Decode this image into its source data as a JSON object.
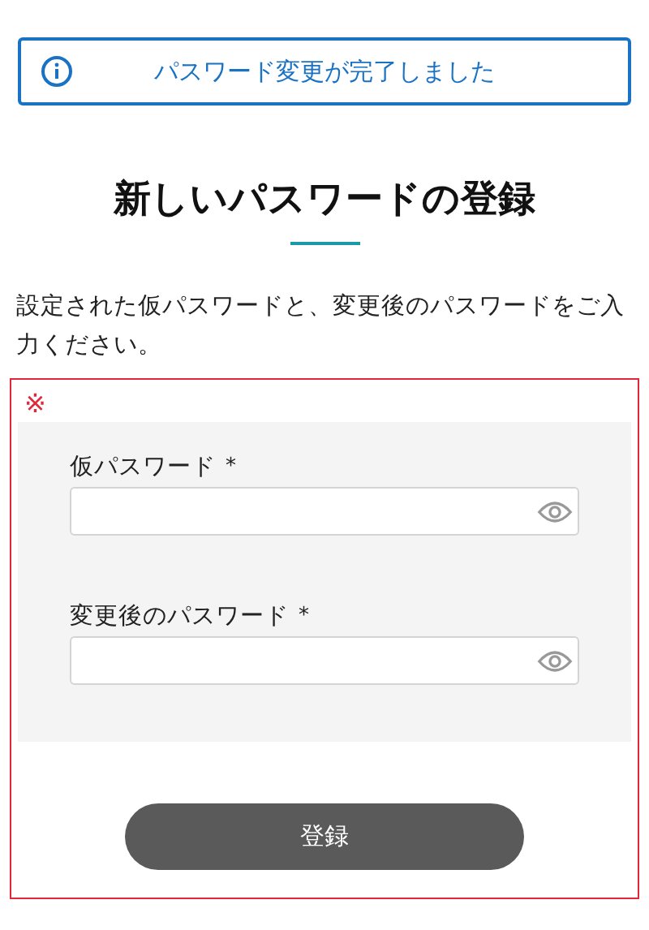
{
  "notice": {
    "text": "パスワード変更が完了しました"
  },
  "title": "新しいパスワードの登録",
  "description": "設定された仮パスワードと、変更後のパスワードをご入力ください。",
  "form": {
    "mark": "※",
    "fields": [
      {
        "label": "仮パスワード",
        "required_mark": "*"
      },
      {
        "label": "変更後のパスワード",
        "required_mark": "*"
      }
    ],
    "submit": "登録"
  }
}
